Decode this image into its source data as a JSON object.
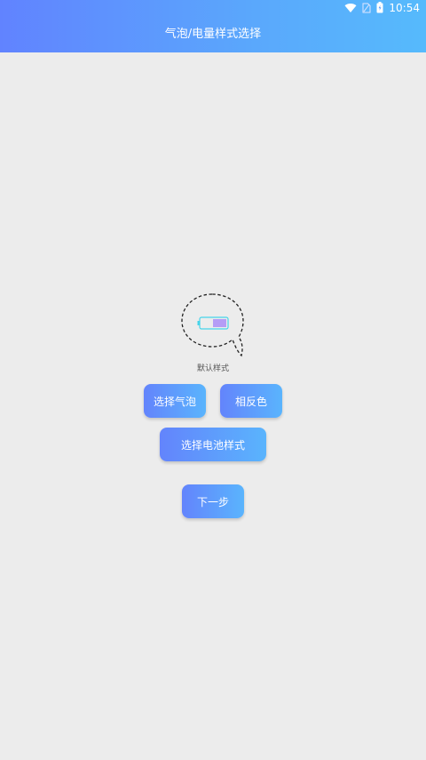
{
  "status_bar": {
    "time": "10:54",
    "icons": [
      "wifi-icon",
      "sim-card-icon",
      "battery-icon"
    ]
  },
  "header": {
    "title": "气泡/电量样式选择"
  },
  "preview": {
    "style_label": "默认样式"
  },
  "buttons": {
    "select_bubble": "选择气泡",
    "invert_color": "相反色",
    "select_battery_style": "选择电池样式",
    "next_step": "下一步"
  },
  "colors": {
    "header_gradient_start": "#6183ff",
    "header_gradient_end": "#56bafc",
    "button_gradient_start": "#6384fc",
    "button_gradient_end": "#5ab4fd",
    "background": "#ececec"
  }
}
